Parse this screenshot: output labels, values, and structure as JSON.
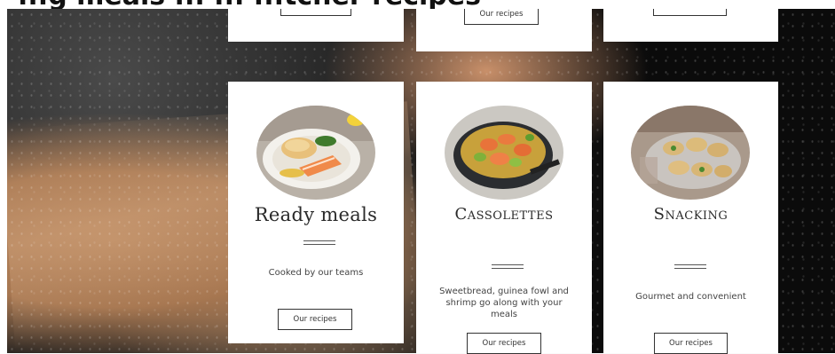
{
  "page": {
    "top_heading_fragment": "...g meals ... ... ...tcher recipes"
  },
  "top_cards": [
    {
      "button_label": ""
    },
    {
      "button_label": "Our recipes"
    },
    {
      "button_label": ""
    }
  ],
  "cards": [
    {
      "title": "Ready meals",
      "description": "Cooked by our teams",
      "button_label": "Our recipes",
      "image_icon": "salmon-plate-image"
    },
    {
      "title": "Cassolettes",
      "description": "Sweetbread, guinea fowl and shrimp go along with your meals",
      "button_label": "Our recipes",
      "image_icon": "shrimp-cassolette-image"
    },
    {
      "title": "Snacking",
      "description": "Gourmet and convenient",
      "button_label": "Our recipes",
      "image_icon": "snacking-tartlets-image"
    }
  ],
  "colors": {
    "card_bg": "#ffffff",
    "text": "#2a2a2a",
    "button_border": "#333333",
    "background_dark": "#0b0b0b",
    "skin_tone": "#b8875f"
  }
}
